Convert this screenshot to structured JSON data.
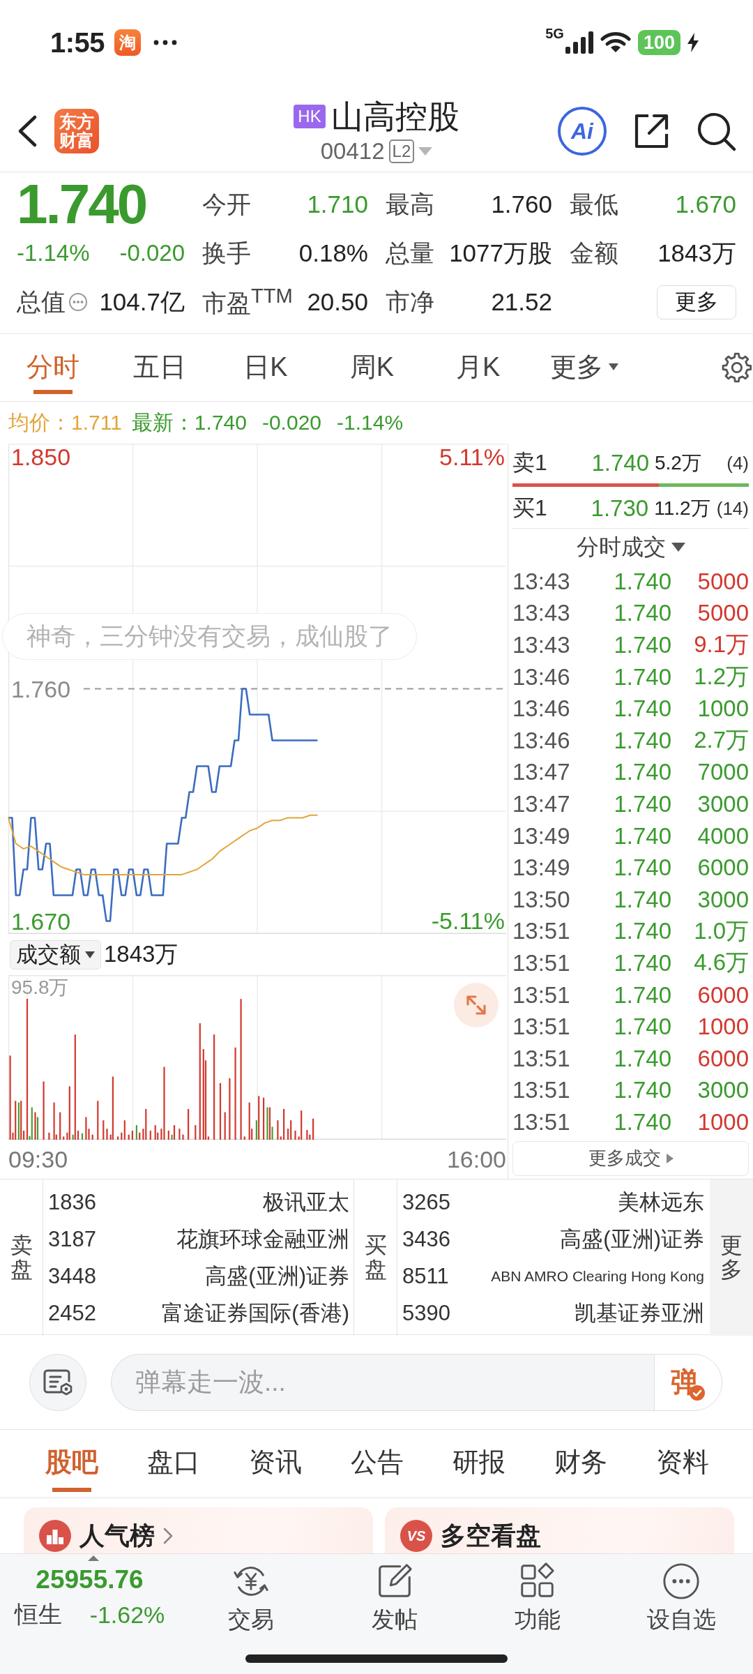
{
  "status_bar": {
    "time": "1:55",
    "app_badge": "淘",
    "network": "5G",
    "battery": "100",
    "charging": true
  },
  "header": {
    "logo": "东方财富",
    "market": "HK",
    "name": "山高控股",
    "code": "00412",
    "level_badge": "L2",
    "ai_badge": "Ai"
  },
  "quote": {
    "price": "1.740",
    "change_pct": "-1.14%",
    "change": "-0.020",
    "color": "#3a9a2e",
    "stats": [
      {
        "label": "今开",
        "value": "1.710",
        "color": "#3a9a2e"
      },
      {
        "label": "最高",
        "value": "1.760",
        "color": "#222222"
      },
      {
        "label": "最低",
        "value": "1.670",
        "color": "#3a9a2e"
      },
      {
        "label": "换手",
        "value": "0.18%",
        "color": "#222222"
      },
      {
        "label": "总量",
        "value": "1077万股",
        "color": "#222222"
      },
      {
        "label": "金额",
        "value": "1843万",
        "color": "#222222"
      },
      {
        "label": "市盈$^{TTM}$",
        "value": "20.50",
        "color": "#222222"
      },
      {
        "label": "市净",
        "value": "21.52",
        "color": "#222222"
      }
    ],
    "market_cap": {
      "label": "总值",
      "value": "104.7亿"
    },
    "more": "更多"
  },
  "chart_tabs": [
    {
      "label": "分时",
      "kind": "tab",
      "selected": true
    },
    {
      "label": "五日",
      "kind": "tab",
      "selected": false
    },
    {
      "label": "日K",
      "kind": "tab",
      "selected": false
    },
    {
      "label": "周K",
      "kind": "tab",
      "selected": false
    },
    {
      "label": "月K",
      "kind": "tab",
      "selected": false
    },
    {
      "label": "更多",
      "kind": "menu",
      "selected": false
    }
  ],
  "legend": {
    "avg": "1.711",
    "last_label": "最新：",
    "last": "1.740",
    "change": "-0.020",
    "change_pct": "-1.14%",
    "color": "#3a9a2e"
  },
  "price_chart": {
    "top_pct": "5.11%",
    "bottom_pct": "-5.11%",
    "danmaku": "神奇，三分钟没有交易，成仙股了",
    "time_labels": [
      "09:30",
      "16:00"
    ],
    "chart_data": {
      "type": "line",
      "categories": [
        null,
        null,
        null,
        null,
        null,
        null,
        null,
        null,
        null,
        null,
        null,
        null,
        null,
        null,
        null,
        null,
        null,
        null,
        null,
        null,
        null,
        null,
        null,
        null,
        null,
        null,
        null,
        null,
        null,
        null,
        null,
        null,
        null,
        null,
        null,
        null,
        null,
        null,
        null,
        null,
        null,
        null,
        null,
        null,
        null,
        null,
        null,
        null,
        null,
        null,
        null,
        null,
        null,
        null,
        null,
        null,
        null,
        null,
        null,
        null,
        null,
        null,
        null,
        null,
        null,
        null,
        null,
        null,
        null,
        null,
        null,
        null,
        null,
        null,
        null,
        null,
        null,
        null,
        null,
        null,
        null,
        null,
        null
      ],
      "series": [
        {
          "color": "#3b6cc0",
          "values": [
            1.71,
            1.71,
            1.68,
            1.68,
            1.69,
            1.69,
            1.71,
            1.71,
            1.69,
            1.69,
            1.7,
            1.7,
            1.68,
            1.68,
            1.68,
            1.68,
            1.68,
            1.68,
            1.69,
            1.69,
            1.68,
            1.68,
            1.69,
            1.69,
            1.68,
            1.68,
            1.67,
            1.67,
            1.69,
            1.69,
            1.68,
            1.68,
            1.69,
            1.69,
            1.68,
            1.68,
            1.69,
            1.69,
            1.68,
            1.68,
            1.68,
            1.68,
            1.7,
            1.7,
            1.7,
            1.7,
            1.71,
            1.71,
            1.72,
            1.72,
            1.73,
            1.73,
            1.73,
            1.73,
            1.72,
            1.72,
            1.73,
            1.73,
            1.73,
            1.73,
            1.74,
            1.74,
            1.76,
            1.76,
            1.75,
            1.75,
            1.75,
            1.75,
            1.75,
            1.75,
            1.74,
            1.74,
            1.74,
            1.74,
            1.74,
            1.74,
            1.74,
            1.74,
            1.74,
            1.74,
            1.74,
            1.74,
            1.74
          ]
        },
        {
          "name": "均价：",
          "color": "#e2a53a",
          "values": [
            1.71,
            1.705,
            1.7,
            1.699,
            1.698,
            1.6985,
            1.699,
            1.698,
            1.697,
            1.696,
            1.695,
            1.694,
            1.693,
            1.692,
            1.691,
            1.6905,
            1.69,
            1.6895,
            1.689,
            1.6885,
            1.688,
            1.688,
            1.688,
            1.688,
            1.688,
            1.688,
            1.688,
            1.688,
            1.688,
            1.688,
            1.688,
            1.688,
            1.688,
            1.688,
            1.688,
            1.688,
            1.688,
            1.688,
            1.688,
            1.688,
            1.688,
            1.688,
            1.688,
            1.688,
            1.688,
            1.688,
            1.688,
            1.6885,
            1.689,
            1.6895,
            1.69,
            1.691,
            1.692,
            1.693,
            1.694,
            1.6955,
            1.697,
            1.698,
            1.699,
            1.7,
            1.701,
            1.702,
            1.703,
            1.704,
            1.705,
            1.7055,
            1.706,
            1.707,
            1.708,
            1.7085,
            1.709,
            1.709,
            1.709,
            1.7095,
            1.71,
            1.71,
            1.71,
            1.71,
            1.71,
            1.7105,
            1.711,
            1.711,
            1.711
          ]
        }
      ],
      "ylim": [
        1.665,
        1.855
      ],
      "yticks": [
        {
          "value": 1.85,
          "label": "1.850"
        },
        {
          "value": 1.76,
          "label": "1.760"
        },
        {
          "value": 1.67,
          "label": "1.670"
        }
      ],
      "ref_lines": [
        {
          "axis": "y",
          "value": 1.76
        }
      ]
    }
  },
  "volume": {
    "selector": "成交额",
    "total": "1843万",
    "max_label": "95.8万"
  },
  "order_book": {
    "rows": [
      {
        "label": "卖1",
        "price": "1.740",
        "volume": "5.2万",
        "count": "(4)",
        "color": "#3a9a2e"
      },
      {
        "label": "买1",
        "price": "1.730",
        "volume": "11.2万",
        "count": "(14)",
        "color": "#3a9a2e"
      }
    ],
    "ratio_bar": {
      "level": 0.62
    }
  },
  "trades": {
    "title": "分时成交",
    "color": "#3a9a2e",
    "rows": [
      {
        "time": "13:43",
        "price": "1.740",
        "volume": "5000",
        "color": "#d2382e"
      },
      {
        "time": "13:43",
        "price": "1.740",
        "volume": "5000",
        "color": "#d2382e"
      },
      {
        "time": "13:43",
        "price": "1.740",
        "volume": "9.1万",
        "color": "#d2382e"
      },
      {
        "time": "13:46",
        "price": "1.740",
        "volume": "1.2万",
        "color": "#3a9a2e"
      },
      {
        "time": "13:46",
        "price": "1.740",
        "volume": "1000",
        "color": "#3a9a2e"
      },
      {
        "time": "13:46",
        "price": "1.740",
        "volume": "2.7万",
        "color": "#3a9a2e"
      },
      {
        "time": "13:47",
        "price": "1.740",
        "volume": "7000",
        "color": "#3a9a2e"
      },
      {
        "time": "13:47",
        "price": "1.740",
        "volume": "3000",
        "color": "#3a9a2e"
      },
      {
        "time": "13:49",
        "price": "1.740",
        "volume": "4000",
        "color": "#3a9a2e"
      },
      {
        "time": "13:49",
        "price": "1.740",
        "volume": "6000",
        "color": "#3a9a2e"
      },
      {
        "time": "13:50",
        "price": "1.740",
        "volume": "3000",
        "color": "#3a9a2e"
      },
      {
        "time": "13:51",
        "price": "1.740",
        "volume": "1.0万",
        "color": "#3a9a2e"
      },
      {
        "time": "13:51",
        "price": "1.740",
        "volume": "4.6万",
        "color": "#3a9a2e"
      },
      {
        "time": "13:51",
        "price": "1.740",
        "volume": "6000",
        "color": "#d2382e"
      },
      {
        "time": "13:51",
        "price": "1.740",
        "volume": "1000",
        "color": "#d2382e"
      },
      {
        "time": "13:51",
        "price": "1.740",
        "volume": "6000",
        "color": "#d2382e"
      },
      {
        "time": "13:51",
        "price": "1.740",
        "volume": "3000",
        "color": "#3a9a2e"
      },
      {
        "time": "13:51",
        "price": "1.740",
        "volume": "1000",
        "color": "#d2382e"
      }
    ],
    "more": "更多成交"
  },
  "brokers": {
    "sell_label": "卖盘",
    "buy_label": "买盘",
    "more": "更多",
    "sell": [
      {
        "id": "1836",
        "name": "极讯亚太"
      },
      {
        "id": "3187",
        "name": "花旗环球金融亚洲"
      },
      {
        "id": "3448",
        "name": "高盛(亚洲)证券"
      },
      {
        "id": "2452",
        "name": "富途证券国际(香港)"
      }
    ],
    "buy": [
      {
        "id": "3265",
        "name": "美林远东"
      },
      {
        "id": "3436",
        "name": "高盛(亚洲)证券"
      },
      {
        "id": "8511",
        "name": "ABN AMRO Clearing Hong Kong"
      },
      {
        "id": "5390",
        "name": "凯基证券亚洲"
      }
    ]
  },
  "comment_bar": {
    "placeholder": "弹幕走一波...",
    "send": "弹"
  },
  "bottom_tabs": [
    {
      "label": "股吧",
      "selected": true
    },
    {
      "label": "盘口",
      "selected": false
    },
    {
      "label": "资讯",
      "selected": false
    },
    {
      "label": "公告",
      "selected": false
    },
    {
      "label": "研报",
      "selected": false
    },
    {
      "label": "财务",
      "selected": false
    },
    {
      "label": "资料",
      "selected": false
    }
  ],
  "cards": [
    {
      "title": "人气榜",
      "kind": "ranking"
    },
    {
      "title": "多空看盘",
      "kind": "versus",
      "badge": "VS"
    }
  ],
  "bottom_nav": {
    "index": {
      "value": "25955.76",
      "name": "恒生",
      "change": "-1.62%",
      "color": "#3a9a2e"
    },
    "items": [
      {
        "label": "交易",
        "kind": "trade"
      },
      {
        "label": "发帖",
        "kind": "post"
      },
      {
        "label": "功能",
        "kind": "apps"
      },
      {
        "label": "设自选",
        "kind": "watchlist"
      }
    ]
  }
}
